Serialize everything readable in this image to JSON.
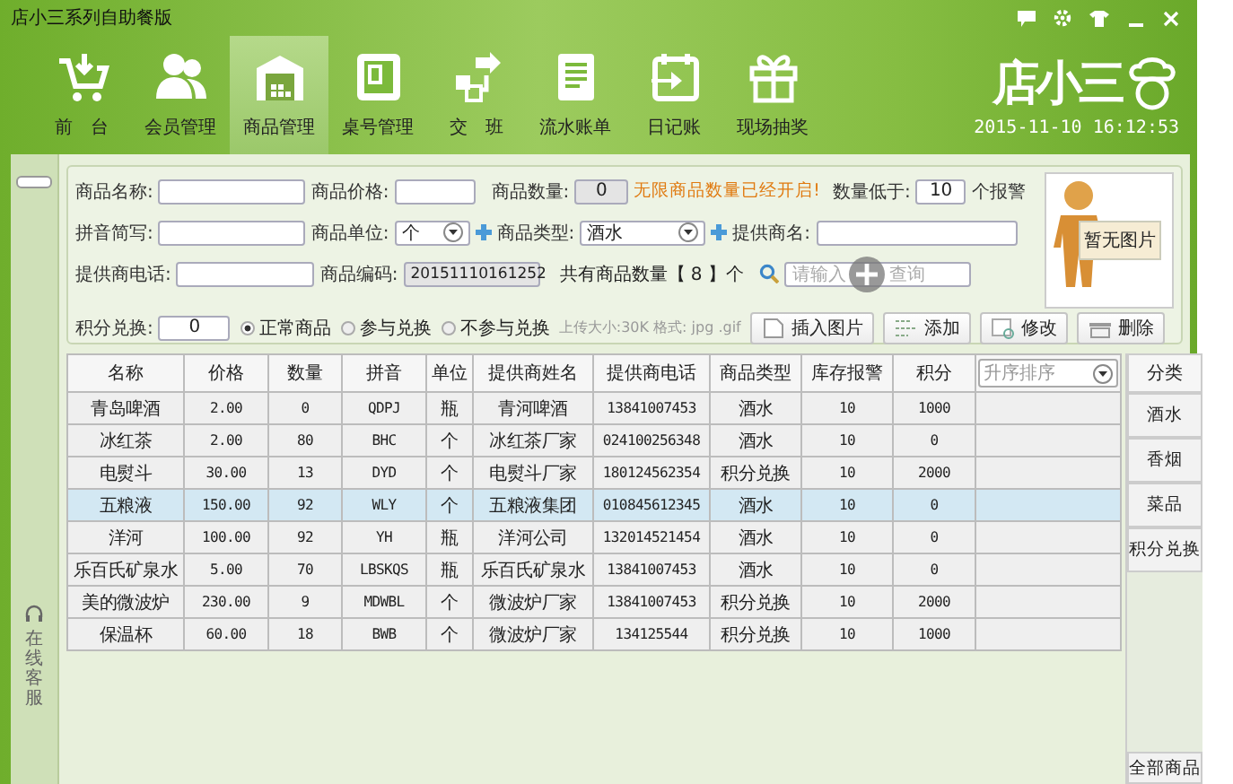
{
  "window": {
    "title": "店小三系列自助餐版"
  },
  "nav": {
    "items": [
      {
        "label": "前　台",
        "kind": "cart",
        "selected": false
      },
      {
        "label": "会员管理",
        "kind": "members",
        "selected": false
      },
      {
        "label": "商品管理",
        "kind": "warehouse",
        "selected": true
      },
      {
        "label": "桌号管理",
        "kind": "table",
        "selected": false
      },
      {
        "label": "交　班",
        "kind": "swap",
        "selected": false
      },
      {
        "label": "流水账单",
        "kind": "bill",
        "selected": false
      },
      {
        "label": "日记账",
        "kind": "calendar",
        "selected": false
      },
      {
        "label": "现场抽奖",
        "kind": "gift",
        "selected": false
      }
    ]
  },
  "brand": {
    "logo": "店小三",
    "clock": "2015-11-10 16:12:53"
  },
  "side": {
    "service": "在线客服"
  },
  "form": {
    "name_label": "商品名称:",
    "price_label": "商品价格:",
    "qty_label": "商品数量:",
    "qty_value": "0",
    "unlimited_notice": "无限商品数量已经开启!",
    "alarm_label": "数量低于:",
    "alarm_value": "10",
    "alarm_suffix": "个报警",
    "pinyin_label": "拼音简写:",
    "unit_label": "商品单位:",
    "unit_value": "个",
    "type_label": "商品类型:",
    "type_value": "酒水",
    "supplier_label": "提供商名:",
    "phone_label": "提供商电话:",
    "code_label": "商品编码:",
    "code_value": "20151110161252",
    "total_text": "共有商品数量【 8 】个",
    "search": {
      "placeholder": "请输入",
      "placeholder_end": "查询"
    },
    "points_label": "积分兑换:",
    "points_value": "0",
    "radios": [
      {
        "label": "正常商品",
        "selected": true
      },
      {
        "label": "参与兑换",
        "selected": false
      },
      {
        "label": "不参与兑换",
        "selected": false
      }
    ],
    "upload_hint": "上传大小:30K 格式: jpg .gif",
    "image_caption": "暂无图片",
    "buttons": [
      {
        "label": "插入图片",
        "kind": "image"
      },
      {
        "label": "添加",
        "kind": "add"
      },
      {
        "label": "修改",
        "kind": "edit"
      },
      {
        "label": "删除",
        "kind": "delete"
      }
    ]
  },
  "table": {
    "columns": [
      "名称",
      "价格",
      "数量",
      "拼音",
      "单位",
      "提供商姓名",
      "提供商电话",
      "商品类型",
      "库存报警",
      "积分"
    ],
    "sort": {
      "value": "升序排序"
    },
    "rows": [
      {
        "cells": [
          "青岛啤酒",
          "2.00",
          "0",
          "QDPJ",
          "瓶",
          "青河啤酒",
          "13841007453",
          "酒水",
          "10",
          "1000"
        ],
        "selected": false
      },
      {
        "cells": [
          "冰红茶",
          "2.00",
          "80",
          "BHC",
          "个",
          "冰红茶厂家",
          "024100256348",
          "酒水",
          "10",
          "0"
        ],
        "selected": false
      },
      {
        "cells": [
          "电熨斗",
          "30.00",
          "13",
          "DYD",
          "个",
          "电熨斗厂家",
          "180124562354",
          "积分兑换",
          "10",
          "2000"
        ],
        "selected": false
      },
      {
        "cells": [
          "五粮液",
          "150.00",
          "92",
          "WLY",
          "个",
          "五粮液集团",
          "010845612345",
          "酒水",
          "10",
          "0"
        ],
        "selected": true
      },
      {
        "cells": [
          "洋河",
          "100.00",
          "92",
          "YH",
          "瓶",
          "洋河公司",
          "132014521454",
          "酒水",
          "10",
          "0"
        ],
        "selected": false
      },
      {
        "cells": [
          "乐百氏矿泉水",
          "5.00",
          "70",
          "LBSKQS",
          "瓶",
          "乐百氏矿泉水",
          "13841007453",
          "酒水",
          "10",
          "0"
        ],
        "selected": false
      },
      {
        "cells": [
          "美的微波炉",
          "230.00",
          "9",
          "MDWBL",
          "个",
          "微波炉厂家",
          "13841007453",
          "积分兑换",
          "10",
          "2000"
        ],
        "selected": false
      },
      {
        "cells": [
          "保温杯",
          "60.00",
          "18",
          "BWB",
          "个",
          "微波炉厂家",
          "134125544",
          "积分兑换",
          "10",
          "1000"
        ],
        "selected": false
      }
    ]
  },
  "categories": {
    "header": "分类",
    "items": [
      "酒水",
      "香烟",
      "菜品",
      "积分兑换"
    ],
    "all": "全部商品"
  }
}
